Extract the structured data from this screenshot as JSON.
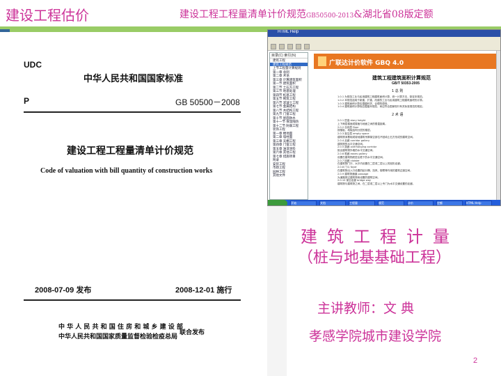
{
  "header": {
    "title_left": "建设工程估价",
    "title_right_a": "建设工程工程量清单计价规范",
    "title_right_code": "GB50500-2013",
    "title_right_b": "&湖北省08版定额"
  },
  "cover": {
    "udc": "UDC",
    "p": "P",
    "standard_title": "中华人民共和国国家标准",
    "gb_code": "GB 50500－2008",
    "doc_title": "建设工程工程量清单计价规范",
    "doc_title_en": "Code of valuation with bill quantity of construction works",
    "publish_date": "2008-07-09 发布",
    "implement_date": "2008-12-01 施行",
    "authority_1": "中 华 人 民 共 和 国 住 房 和 城 乡 建 设 部",
    "authority_2": "中华人民共和国国家质量监督检验检疫总局",
    "joint_release": "联合发布"
  },
  "window": {
    "title": "HTML Help",
    "tree_tabs": "目录(C)  索引(N)",
    "tree_nodes": [
      "建筑工程",
      "建筑工程规范",
      "上节工程量计算规则",
      "第一章 总则",
      "第二章 术语",
      "第三章 计算建筑面积",
      "第一节 建筑面积",
      "第二节 土石方工程",
      "第三节 地基处理",
      "第四节 桩基工程",
      "第五节 砌筑工程",
      "第六节 混凝土工程",
      "第七节 金属结构",
      "第八节 木结构工程",
      "第九节 门窗工程",
      "第十节 屋面防水",
      "第十一节 保温隔热",
      "第十二节 防腐工程",
      "装饰工程",
      "第一章 楼地面",
      "第二章 墙柱面",
      "第三章 天棚工程",
      "第四章 门窗工程",
      "第五章 油漆涂料",
      "第六章 其他工程",
      "第七章 措施项目",
      "附录",
      "安装工程",
      "市政工程",
      "园林工程",
      "其他文件"
    ],
    "selected_node": 1,
    "banner_logo": "广联达计价软件 GBQ 4.0",
    "doc_heading": "建筑工程建筑面积计算规范",
    "doc_gb": "GB/T 50353-2005",
    "section_1": "1  总  则",
    "section_2": "2  术  语",
    "paragraphs_1": [
      "1.0.1  为规范工业与民用建筑工程建筑面积计算，统一计算方法，制定本规范。",
      "1.0.2  本规范适用于新建、扩建、改建的工业与民用建筑工程建筑面积的计算。",
      "1.0.3  建筑面积计算应遵循科学、合理的原则。",
      "1.0.4  建筑面积计算除应遵循本规范，尚应符合国家现行有关标准规范的规定。"
    ],
    "paragraphs_2": [
      "2.0.1  层高 story height",
      "上下两层楼面或楼面与地面之间的垂直距离。",
      "2.0.2  自然层 floor",
      "按楼板、地板结构分层的楼层。",
      "2.0.3  架空层 empty space",
      "建筑物深基础或坡地建筑吊脚架空部位不回填土石方形成的建筑空间。",
      "2.0.4  走廊 corridor gallery",
      "建筑物的水平交通空间。",
      "2.0.5  挑廊 overhanging corridor",
      "挑出建筑物外墙的水平交通空间。",
      "2.0.6  檐廊 eaves gallery",
      "设置在建筑物底层出檐下的水平交通空间。",
      "2.0.7  回廊 cloister",
      "在建筑物门厅、大厅内设置在二层或二层以上的回形走廊。",
      "2.0.8  门斗 foyer",
      "在建筑物出入口设置的起分隔、挡风、御寒等作用的建筑过渡空间。",
      "2.0.9  建筑物通道 passage",
      "为道路穿过建筑物而设置的建筑空间。",
      "2.0.10  架空走廊 bridge way",
      "建筑物与建筑物之间，在二层或二层以上专门为水平交通设置的走廊。"
    ],
    "taskbar_items": [
      "开始",
      "文档",
      "工程量",
      "规范",
      "计价",
      "定额",
      "HTML Help"
    ]
  },
  "course": {
    "line1": "建筑工程计量",
    "line2": "（桩与地基基础工程）",
    "teacher": "主讲教师：文  典",
    "school": "孝感学院城市建设学院"
  },
  "page_number": "2"
}
